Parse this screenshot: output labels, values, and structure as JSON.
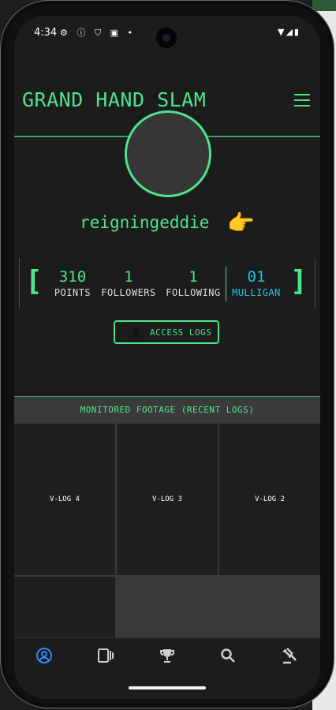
{
  "status": {
    "time": "4:34",
    "left_icons": "⚙ ⓘ ⛉ ▣ •",
    "right_icons": "▼◢▮"
  },
  "app": {
    "title": "GRAND HAND SLAM"
  },
  "profile": {
    "username": "reigningeddie",
    "emoji": "👉"
  },
  "stats": {
    "bracket_left": "[",
    "bracket_right": "]",
    "items": [
      {
        "value": "310",
        "label": "POINTS"
      },
      {
        "value": "1",
        "label": "FOLLOWERS"
      },
      {
        "value": "1",
        "label": "FOLLOWING"
      },
      {
        "value": "01",
        "label": "MULLIGAN"
      }
    ]
  },
  "access_button": {
    "label": "ACCESS LOGS"
  },
  "footage": {
    "header": "MONITORED FOOTAGE (RECENT LOGS)",
    "tiles": [
      "V-LOG 4",
      "V-LOG 3",
      "V-LOG 2"
    ]
  },
  "colors": {
    "accent": "#4fe48e",
    "cyan": "#18c6e6",
    "background": "#1c1c1c",
    "nav_active": "#2f8ef5"
  },
  "nav": {
    "items": [
      "profile-icon",
      "cards-icon",
      "trophy-icon",
      "search-icon",
      "gavel-icon"
    ],
    "active": "profile-icon"
  }
}
